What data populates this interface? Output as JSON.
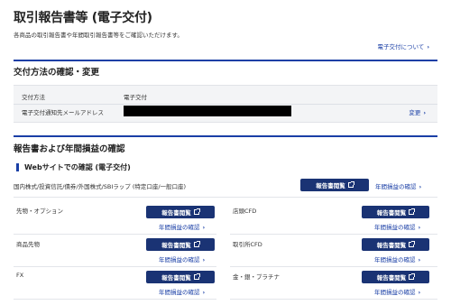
{
  "page": {
    "title": "取引報告書等 (電子交付)",
    "description": "各商品の取引報告書や年間取引報告書等をご確認いただけます。",
    "about_link": "電子交付について"
  },
  "delivery": {
    "section_title": "交付方法の確認・変更",
    "method_label": "交付方法",
    "method_value": "電子交付",
    "email_label": "電子交付通知先メールアドレス",
    "change_label": "変更"
  },
  "reports": {
    "section_title": "報告書および年間損益の確認",
    "web_subtitle": "Webサイトでの確認 (電子交付)",
    "view_label": "報告書閲覧",
    "annual_label": "年間損益の確認",
    "first_product": "国内株式/投資信託/債券/外国株式/SBIラップ (特定口座/一般口座)",
    "left_products": [
      "先物・オプション",
      "商品先物",
      "FX"
    ],
    "right_products": [
      "店頭CFD",
      "取引所CFD",
      "金・銀・プラチナ"
    ]
  }
}
